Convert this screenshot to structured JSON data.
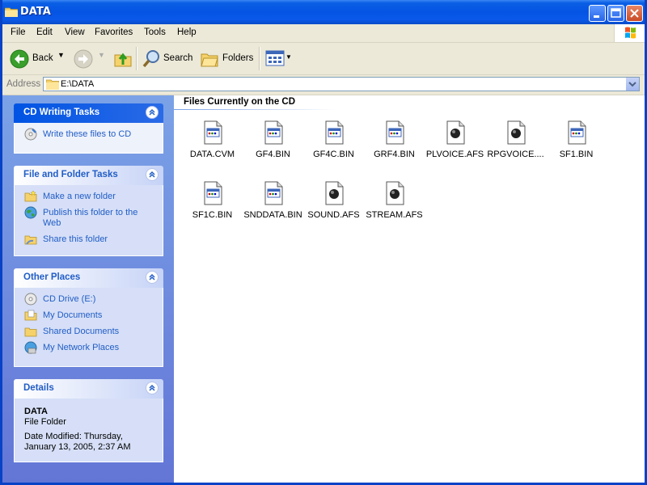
{
  "window": {
    "title": "DATA"
  },
  "menu": [
    "File",
    "Edit",
    "View",
    "Favorites",
    "Tools",
    "Help"
  ],
  "toolbar": {
    "back": "Back",
    "search": "Search",
    "folders": "Folders"
  },
  "address": {
    "label": "Address",
    "value": "E:\\DATA"
  },
  "left_pane": {
    "cd_tasks": {
      "title": "CD Writing Tasks",
      "items": [
        "Write these files to CD"
      ]
    },
    "file_tasks": {
      "title": "File and Folder Tasks",
      "items": [
        "Make a new folder",
        "Publish this folder to the Web",
        "Share this folder"
      ]
    },
    "other_places": {
      "title": "Other Places",
      "items": [
        "CD Drive (E:)",
        "My Documents",
        "Shared Documents",
        "My Network Places"
      ]
    },
    "details": {
      "title": "Details",
      "name": "DATA",
      "type": "File Folder",
      "modified": "Date Modified: Thursday, January 13, 2005, 2:37 AM"
    }
  },
  "content": {
    "section_title": "Files Currently on the CD",
    "files": [
      {
        "name": "DATA.CVM",
        "icon": "generic-file-icon"
      },
      {
        "name": "GF4.BIN",
        "icon": "generic-file-icon"
      },
      {
        "name": "GF4C.BIN",
        "icon": "generic-file-icon"
      },
      {
        "name": "GRF4.BIN",
        "icon": "generic-file-icon"
      },
      {
        "name": "PLVOICE.AFS",
        "icon": "media-file-icon"
      },
      {
        "name": "RPGVOICE....",
        "icon": "media-file-icon"
      },
      {
        "name": "SF1.BIN",
        "icon": "generic-file-icon"
      },
      {
        "name": "SF1C.BIN",
        "icon": "generic-file-icon"
      },
      {
        "name": "SNDDATA.BIN",
        "icon": "generic-file-icon"
      },
      {
        "name": "SOUND.AFS",
        "icon": "media-file-icon"
      },
      {
        "name": "STREAM.AFS",
        "icon": "media-file-icon"
      }
    ]
  }
}
